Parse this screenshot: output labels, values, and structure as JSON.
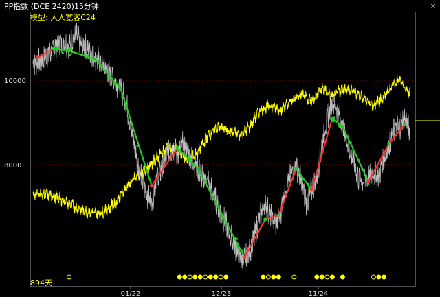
{
  "header": {
    "title": "PP指数  (DCE 2420)15分钟",
    "model": "模型: 人人宽客C24"
  },
  "bars_label": "894天",
  "colors": {
    "background": "#000000",
    "price": "#d0d0d0",
    "indicator": "#ffff00",
    "up_leg": "#ff3030",
    "down_leg": "#22cc22",
    "grid": "#8b0000",
    "axis": "#a0a0a0"
  },
  "chart_data": {
    "type": "line",
    "ylim": [
      7000,
      11000
    ],
    "yticks": [
      8000,
      10000
    ],
    "xticks": [
      "01/22",
      "12/23",
      "11/24"
    ],
    "grid": "dashed horizontal",
    "price_anchors": [
      [
        0,
        10400
      ],
      [
        8,
        10450
      ],
      [
        15,
        10600
      ],
      [
        25,
        10900
      ],
      [
        35,
        10850
      ],
      [
        42,
        11050
      ],
      [
        48,
        10800
      ],
      [
        56,
        10700
      ],
      [
        62,
        10500
      ],
      [
        70,
        10300
      ],
      [
        78,
        10050
      ],
      [
        85,
        9800
      ],
      [
        90,
        9500
      ],
      [
        94,
        9000
      ],
      [
        98,
        8500
      ],
      [
        102,
        8000
      ],
      [
        106,
        7600
      ],
      [
        110,
        7300
      ],
      [
        115,
        7100
      ],
      [
        120,
        7700
      ],
      [
        125,
        7900
      ],
      [
        130,
        8200
      ],
      [
        135,
        8400
      ],
      [
        140,
        8250
      ],
      [
        145,
        8500
      ],
      [
        150,
        8300
      ],
      [
        155,
        8100
      ],
      [
        160,
        7900
      ],
      [
        165,
        7700
      ],
      [
        170,
        7600
      ],
      [
        175,
        7300
      ],
      [
        180,
        7000
      ],
      [
        185,
        6700
      ],
      [
        190,
        6400
      ],
      [
        195,
        6100
      ],
      [
        200,
        5800
      ],
      [
        204,
        5700
      ],
      [
        210,
        5950
      ],
      [
        215,
        6300
      ],
      [
        220,
        6800
      ],
      [
        225,
        7100
      ],
      [
        228,
        6900
      ],
      [
        232,
        6700
      ],
      [
        236,
        6600
      ],
      [
        240,
        6900
      ],
      [
        245,
        7500
      ],
      [
        250,
        7800
      ],
      [
        255,
        8000
      ],
      [
        260,
        7600
      ],
      [
        265,
        7100
      ],
      [
        270,
        7400
      ],
      [
        275,
        7700
      ],
      [
        280,
        8500
      ],
      [
        285,
        9100
      ],
      [
        290,
        9500
      ],
      [
        295,
        9300
      ],
      [
        300,
        8900
      ],
      [
        305,
        8500
      ],
      [
        310,
        8100
      ],
      [
        315,
        7700
      ],
      [
        320,
        7600
      ],
      [
        325,
        7700
      ],
      [
        330,
        7800
      ],
      [
        335,
        7750
      ],
      [
        340,
        8100
      ],
      [
        345,
        8500
      ],
      [
        350,
        8800
      ],
      [
        355,
        8900
      ],
      [
        360,
        9100
      ],
      [
        365,
        8800
      ]
    ],
    "indicator_anchors": [
      [
        0,
        7300
      ],
      [
        10,
        7300
      ],
      [
        20,
        7250
      ],
      [
        30,
        7150
      ],
      [
        40,
        7000
      ],
      [
        50,
        6900
      ],
      [
        60,
        6850
      ],
      [
        70,
        6900
      ],
      [
        80,
        7100
      ],
      [
        90,
        7450
      ],
      [
        100,
        7700
      ],
      [
        110,
        7900
      ],
      [
        120,
        8150
      ],
      [
        130,
        8400
      ],
      [
        140,
        8350
      ],
      [
        150,
        8100
      ],
      [
        160,
        8300
      ],
      [
        170,
        8700
      ],
      [
        180,
        8900
      ],
      [
        190,
        8800
      ],
      [
        200,
        8700
      ],
      [
        210,
        8900
      ],
      [
        220,
        9300
      ],
      [
        230,
        9400
      ],
      [
        240,
        9300
      ],
      [
        250,
        9500
      ],
      [
        260,
        9700
      ],
      [
        270,
        9500
      ],
      [
        280,
        9800
      ],
      [
        290,
        9600
      ],
      [
        300,
        9800
      ],
      [
        310,
        9750
      ],
      [
        320,
        9600
      ],
      [
        330,
        9400
      ],
      [
        340,
        9600
      ],
      [
        350,
        9950
      ],
      [
        355,
        10000
      ],
      [
        360,
        9800
      ],
      [
        365,
        9700
      ]
    ],
    "swing_points": [
      [
        5,
        10550
      ],
      [
        20,
        10750
      ],
      [
        35,
        10700
      ],
      [
        60,
        10500
      ],
      [
        85,
        9800
      ],
      [
        115,
        7500
      ],
      [
        140,
        8400
      ],
      [
        160,
        7900
      ],
      [
        205,
        5800
      ],
      [
        225,
        6700
      ],
      [
        238,
        6800
      ],
      [
        255,
        7900
      ],
      [
        270,
        7400
      ],
      [
        290,
        9100
      ],
      [
        300,
        8900
      ],
      [
        325,
        7600
      ],
      [
        345,
        8500
      ],
      [
        360,
        8950
      ]
    ],
    "markers_x": [
      35,
      142,
      147,
      152,
      157,
      162,
      167,
      172,
      177,
      182,
      187,
      223,
      228,
      233,
      238,
      253,
      275,
      280,
      285,
      290,
      300,
      330,
      335,
      340
    ]
  }
}
